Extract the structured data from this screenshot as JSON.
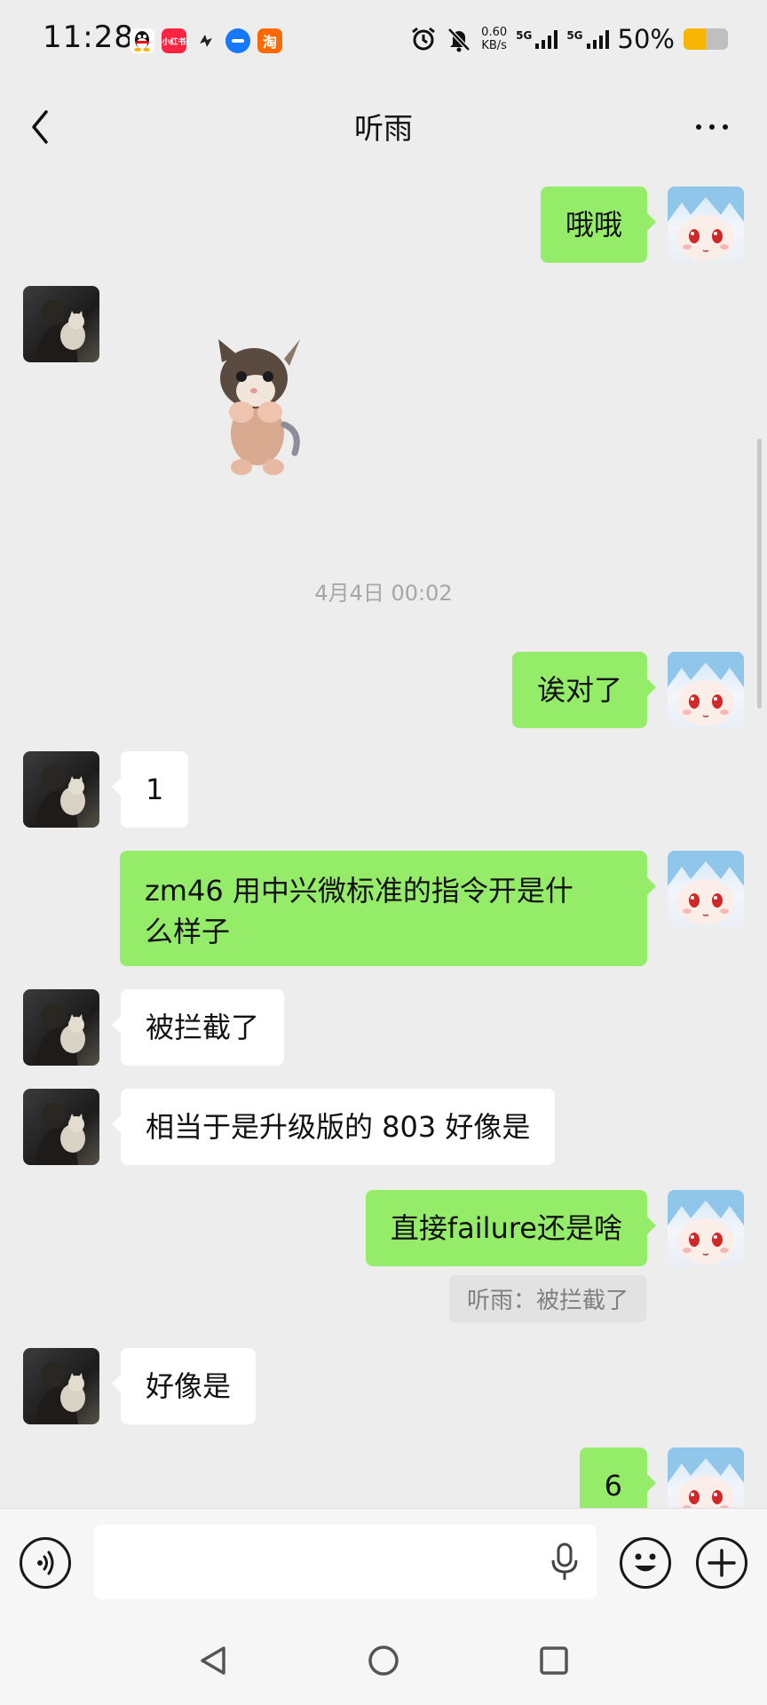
{
  "status_bar": {
    "time": "11:28",
    "notification_icons": [
      "qq-icon",
      "xiaohongshu-icon",
      "app-icon",
      "message-app-icon",
      "taobao-icon"
    ],
    "xiaohongshu_label": "小红书",
    "taobao_label": "淘",
    "net_speed_value": "0.60",
    "net_speed_unit": "KB/s",
    "sim1": "5G",
    "sim2": "5G",
    "battery_percent": "50%",
    "battery_level": 0.5,
    "battery_color": "#f7b500"
  },
  "header": {
    "title": "听雨"
  },
  "chat": {
    "timestamp": "4月4日 00:02",
    "messages": [
      {
        "sender": "me",
        "text": "哦哦"
      },
      {
        "sender": "other",
        "type": "sticker",
        "icon": "dancing-kitten-sticker"
      },
      {
        "sender": "me",
        "text": "诶对了"
      },
      {
        "sender": "other",
        "text": "1"
      },
      {
        "sender": "me",
        "text_line1": "zm46 用中兴微标准的指令开是什",
        "text_line2": "么样子"
      },
      {
        "sender": "other",
        "text": "被拦截了"
      },
      {
        "sender": "other",
        "text": "相当于是升级版的 803 好像是"
      },
      {
        "sender": "me",
        "text": "直接failure还是啥"
      },
      {
        "sender": "other",
        "text": "好像是"
      },
      {
        "sender": "me",
        "text": "6"
      }
    ],
    "quote": "听雨：被拦截了"
  },
  "colors": {
    "my_bubble": "#95ec69",
    "other_bubble": "#ffffff",
    "background": "#ededed"
  }
}
